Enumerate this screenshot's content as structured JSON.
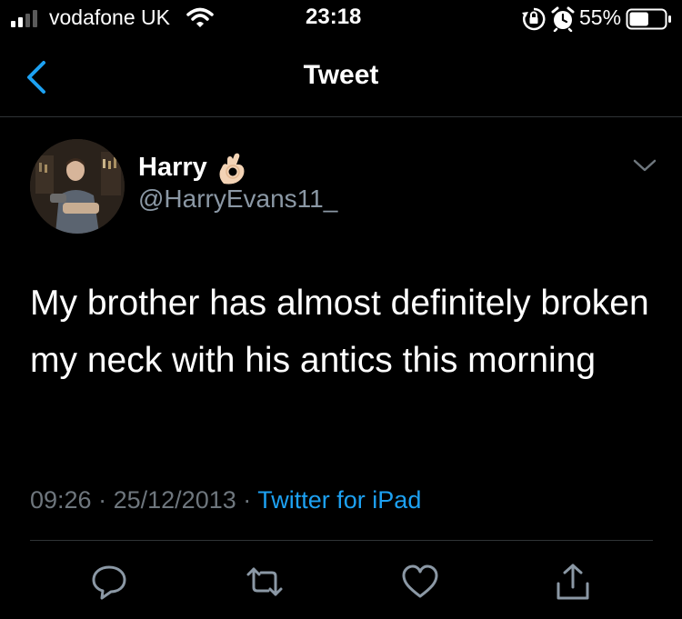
{
  "status_bar": {
    "carrier": "vodafone UK",
    "time": "23:18",
    "battery_percent": "55%",
    "battery_level": 0.55,
    "icons": [
      "signal-icon",
      "wifi-icon",
      "orientation-lock-icon",
      "alarm-icon",
      "battery-icon"
    ]
  },
  "nav": {
    "title": "Tweet",
    "back_icon": "chevron-left-icon"
  },
  "tweet": {
    "display_name": "Harry",
    "name_emoji": "ok-hand-emoji",
    "handle": "@HarryEvans11_",
    "text": "My brother has almost definitely broken my neck with his antics this morning",
    "time": "09:26",
    "date": "25/12/2013",
    "separator": "·",
    "source": "Twitter for iPad",
    "more_icon": "chevron-down-icon"
  },
  "actions": [
    {
      "icon": "reply-icon"
    },
    {
      "icon": "retweet-icon"
    },
    {
      "icon": "like-icon"
    },
    {
      "icon": "share-icon"
    }
  ],
  "colors": {
    "background": "#000000",
    "text": "#ffffff",
    "secondary_text": "#6e767d",
    "link": "#1da1f2",
    "accent": "#1da1f2",
    "divider": "#2f3336"
  }
}
